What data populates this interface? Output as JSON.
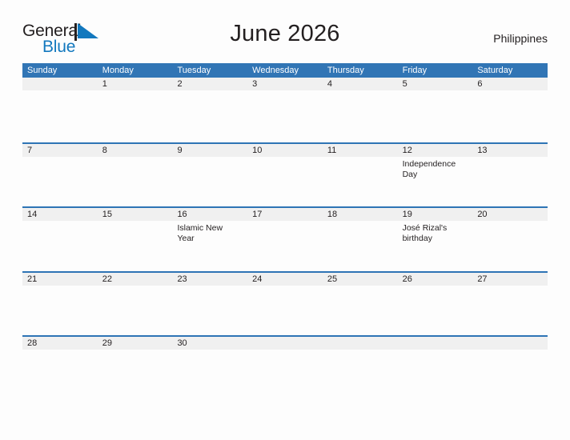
{
  "brand": {
    "name_part1": "General",
    "name_part2": "Blue",
    "flag_icon": "flag-triangle-icon",
    "color_primary": "#1278be",
    "color_text": "#231f20"
  },
  "header": {
    "title": "June 2026",
    "country": "Philippines"
  },
  "theme": {
    "header_blue": "#3175b5",
    "rule_blue": "#2e74b5",
    "band_gray": "#f0f0f0",
    "page_background": "#fdfdfd"
  },
  "calendar": {
    "weekday_headers": [
      "Sunday",
      "Monday",
      "Tuesday",
      "Wednesday",
      "Thursday",
      "Friday",
      "Saturday"
    ],
    "weeks": [
      [
        {
          "day": "",
          "events": []
        },
        {
          "day": "1",
          "events": []
        },
        {
          "day": "2",
          "events": []
        },
        {
          "day": "3",
          "events": []
        },
        {
          "day": "4",
          "events": []
        },
        {
          "day": "5",
          "events": []
        },
        {
          "day": "6",
          "events": []
        }
      ],
      [
        {
          "day": "7",
          "events": []
        },
        {
          "day": "8",
          "events": []
        },
        {
          "day": "9",
          "events": []
        },
        {
          "day": "10",
          "events": []
        },
        {
          "day": "11",
          "events": []
        },
        {
          "day": "12",
          "events": [
            "Independence Day"
          ]
        },
        {
          "day": "13",
          "events": []
        }
      ],
      [
        {
          "day": "14",
          "events": []
        },
        {
          "day": "15",
          "events": []
        },
        {
          "day": "16",
          "events": [
            "Islamic New Year"
          ]
        },
        {
          "day": "17",
          "events": []
        },
        {
          "day": "18",
          "events": []
        },
        {
          "day": "19",
          "events": [
            "José Rizal's birthday"
          ]
        },
        {
          "day": "20",
          "events": []
        }
      ],
      [
        {
          "day": "21",
          "events": []
        },
        {
          "day": "22",
          "events": []
        },
        {
          "day": "23",
          "events": []
        },
        {
          "day": "24",
          "events": []
        },
        {
          "day": "25",
          "events": []
        },
        {
          "day": "26",
          "events": []
        },
        {
          "day": "27",
          "events": []
        }
      ],
      [
        {
          "day": "28",
          "events": []
        },
        {
          "day": "29",
          "events": []
        },
        {
          "day": "30",
          "events": []
        },
        {
          "day": "",
          "events": []
        },
        {
          "day": "",
          "events": []
        },
        {
          "day": "",
          "events": []
        },
        {
          "day": "",
          "events": []
        }
      ]
    ]
  }
}
